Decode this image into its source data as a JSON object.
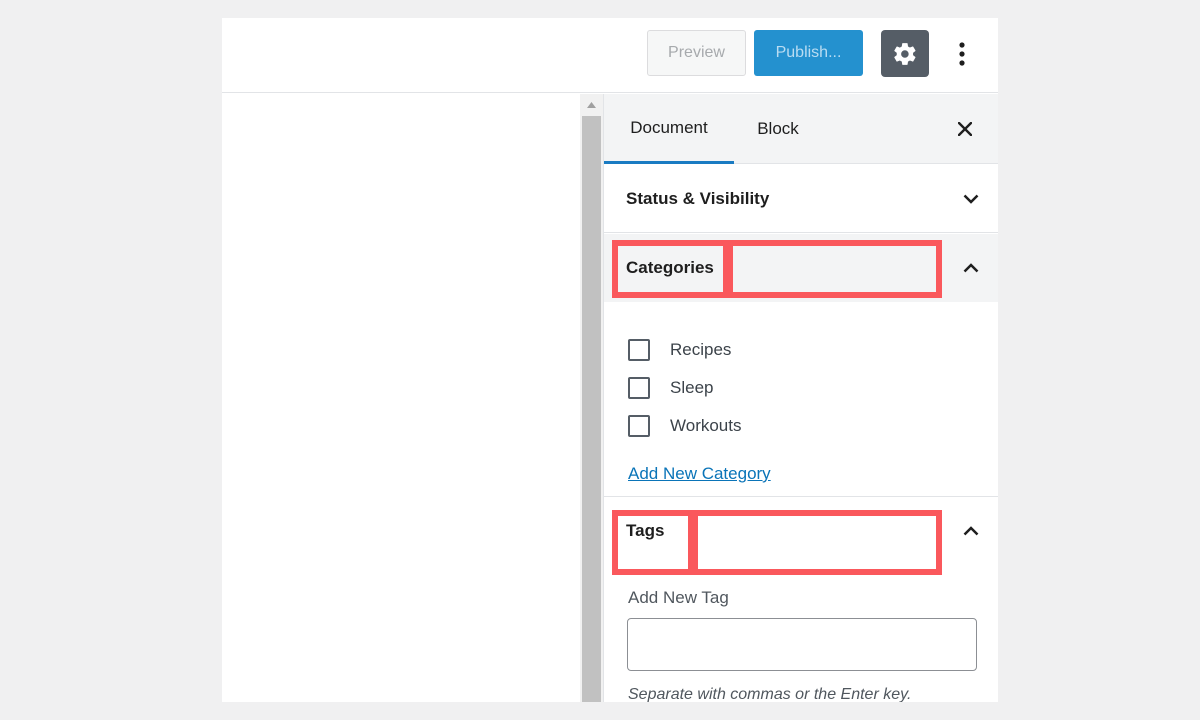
{
  "toolbar": {
    "preview_label": "Preview",
    "publish_label": "Publish...",
    "settings_icon": "gear-icon",
    "more_icon": "vertical-ellipsis-icon"
  },
  "sidebar": {
    "tabs": [
      {
        "label": "Document",
        "active": true
      },
      {
        "label": "Block",
        "active": false
      }
    ],
    "close_icon": "close-icon",
    "panels": {
      "status": {
        "title": "Status & Visibility",
        "expanded": false
      },
      "categories": {
        "title": "Categories",
        "expanded": true,
        "items": [
          {
            "label": "Recipes",
            "checked": false
          },
          {
            "label": "Sleep",
            "checked": false
          },
          {
            "label": "Workouts",
            "checked": false
          }
        ],
        "add_link": "Add New Category"
      },
      "tags": {
        "title": "Tags",
        "expanded": true,
        "input_label": "Add New Tag",
        "input_value": "",
        "help_text": "Separate with commas or the Enter key."
      }
    }
  },
  "colors": {
    "accent": "#2491cf",
    "tab_active_border": "#1a7bc2",
    "highlight": "#fa585c",
    "link": "#0a74b8"
  }
}
